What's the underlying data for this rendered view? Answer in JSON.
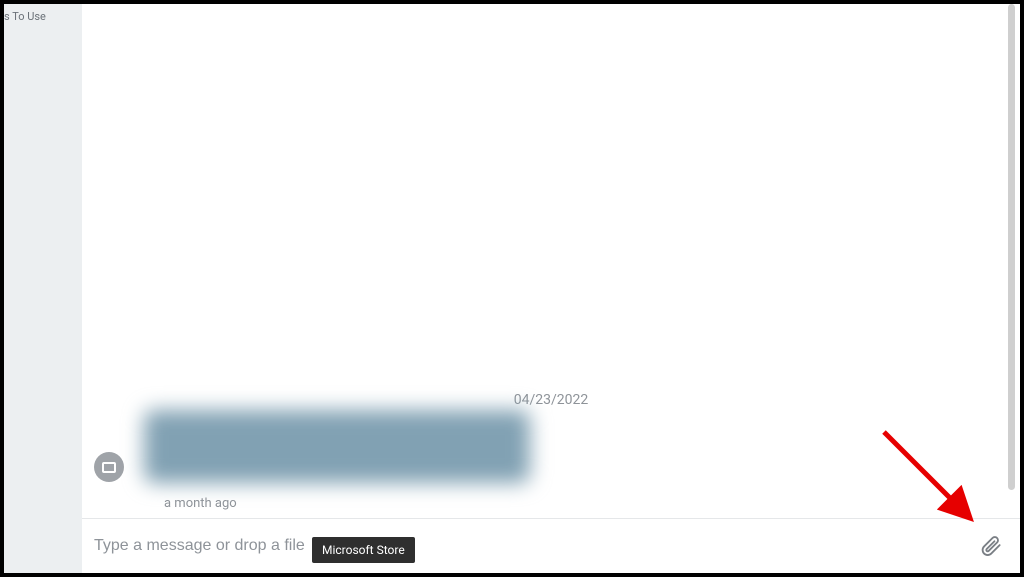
{
  "sidebar": {
    "label_fragment": "s To Use"
  },
  "conversation": {
    "date": "04/23/2022",
    "message_timestamp": "a month ago"
  },
  "composer": {
    "placeholder": "Type a message or drop a file"
  },
  "tooltip": {
    "text": "Microsoft Store"
  },
  "annotation": {
    "arrow_color": "#e60000"
  }
}
